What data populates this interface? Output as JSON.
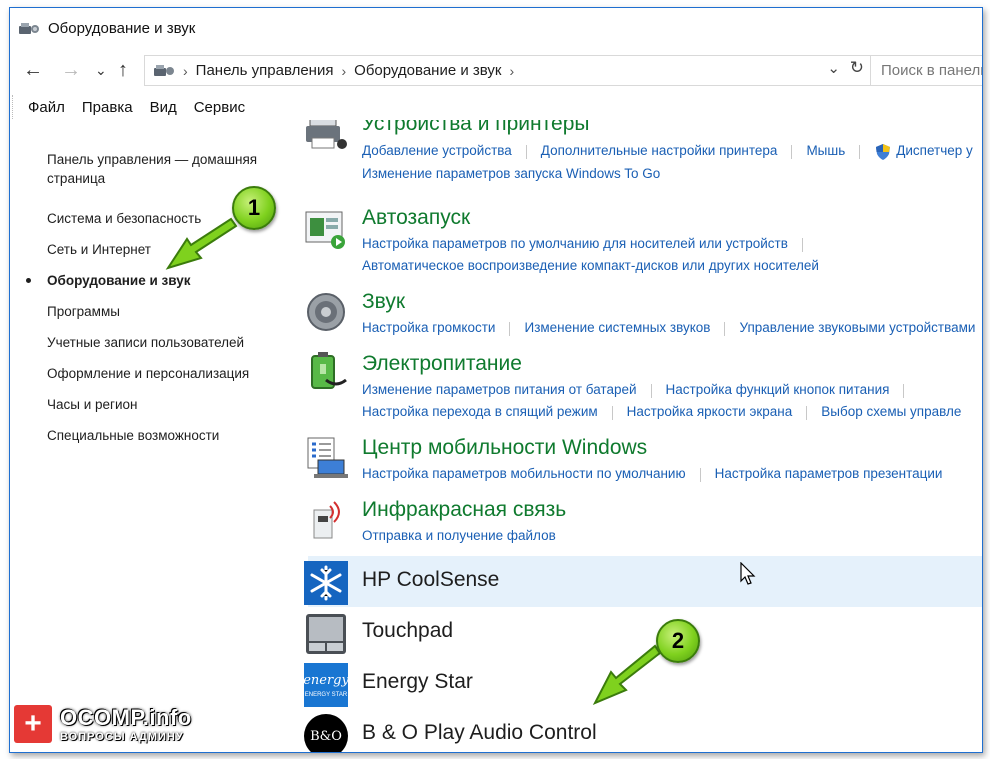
{
  "window": {
    "title": "Оборудование и звук"
  },
  "nav": {
    "back": "←",
    "forward": "→",
    "recent": "⌄",
    "up": "↑"
  },
  "breadcrumb": [
    "Панель управления",
    "Оборудование и звук"
  ],
  "search": {
    "placeholder": "Поиск в панели управления"
  },
  "menu": [
    "Файл",
    "Правка",
    "Вид",
    "Сервис"
  ],
  "sidebar": {
    "home": "Панель управления — домашняя страница",
    "items": [
      "Система и безопасность",
      "Сеть и Интернет",
      "Оборудование и звук",
      "Программы",
      "Учетные записи пользователей",
      "Оформление и персонализация",
      "Часы и регион",
      "Специальные возможности"
    ],
    "active_index": 2
  },
  "categories": [
    {
      "title": "Устройства и принтеры",
      "icon": "printer-icon",
      "lines": [
        [
          "Добавление устройства",
          "Дополнительные настройки принтера",
          "Мышь",
          "Диспетчер у"
        ],
        [
          "Изменение параметров запуска Windows To Go"
        ]
      ]
    },
    {
      "title": "Автозапуск",
      "icon": "autoplay-icon",
      "lines": [
        [
          "Настройка параметров по умолчанию для носителей или устройств"
        ],
        [
          "Автоматическое воспроизведение компакт-дисков или других носителей"
        ]
      ]
    },
    {
      "title": "Звук",
      "icon": "speaker-icon",
      "lines": [
        [
          "Настройка громкости",
          "Изменение системных звуков",
          "Управление звуковыми устройствами"
        ]
      ]
    },
    {
      "title": "Электропитание",
      "icon": "battery-icon",
      "lines": [
        [
          "Изменение параметров питания от батарей",
          "Настройка функций кнопок питания"
        ],
        [
          "Настройка перехода в спящий режим",
          "Настройка яркости экрана",
          "Выбор схемы управле"
        ]
      ]
    },
    {
      "title": "Центр мобильности Windows",
      "icon": "mobility-icon",
      "lines": [
        [
          "Настройка параметров мобильности по умолчанию",
          "Настройка параметров презентации"
        ]
      ]
    },
    {
      "title": "Инфракрасная связь",
      "icon": "infrared-icon",
      "lines": [
        [
          "Отправка и получение файлов"
        ]
      ]
    }
  ],
  "extra": [
    {
      "title": "HP CoolSense",
      "icon": "snowflake-icon"
    },
    {
      "title": "Touchpad",
      "icon": "touchpad-icon"
    },
    {
      "title": "Energy Star",
      "icon": "energy-star-icon",
      "icon_text": "energy",
      "icon_subtext": "ENERGY STAR"
    },
    {
      "title": "B & O Play Audio Control",
      "icon": "bo-logo-icon",
      "icon_text": "B&O"
    }
  ],
  "annotations": {
    "badge1": "1",
    "badge2": "2",
    "arrow_color": "#7fd11e"
  },
  "watermark": {
    "main": "OCOMP.info",
    "sub": "ВОПРОСЫ АДМИНУ",
    "plus": "+"
  },
  "colors": {
    "link": "#1a5fb4",
    "category": "#0f7a2e",
    "hover": "#e5f1fb"
  }
}
